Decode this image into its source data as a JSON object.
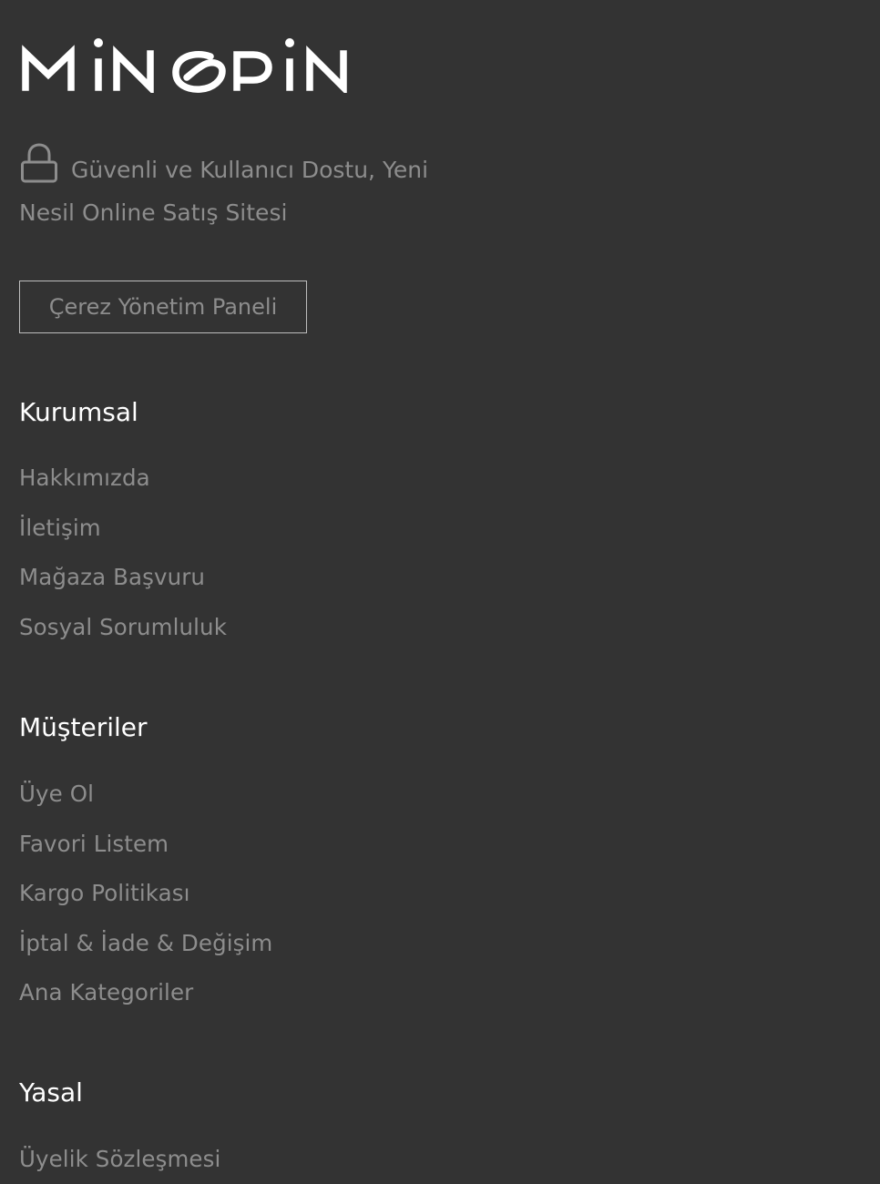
{
  "brand": {
    "logo_text": "MINOPIN"
  },
  "tagline": {
    "text": "Güvenli ve Kullanıcı Dostu, Yeni Nesil Online Satış Sitesi",
    "icon": "lock-icon"
  },
  "cookie_button": {
    "label": "Çerez Yönetim Paneli"
  },
  "sections": {
    "kurumsal": {
      "title": "Kurumsal",
      "links": [
        "Hakkımızda",
        "İletişim",
        "Mağaza Başvuru",
        "Sosyal Sorumluluk"
      ]
    },
    "musteriler": {
      "title": "Müşteriler",
      "links": [
        "Üye Ol",
        "Favori Listem",
        "Kargo Politikası",
        "İptal & İade & Değişim",
        "Ana Kategoriler"
      ]
    },
    "yasal": {
      "title": "Yasal",
      "links": [
        "Üyelik Sözleşmesi"
      ]
    }
  },
  "colors": {
    "background": "#333333",
    "heading": "#ffffff",
    "link": "#8d8d8d",
    "button_border": "#bdbdbd"
  }
}
